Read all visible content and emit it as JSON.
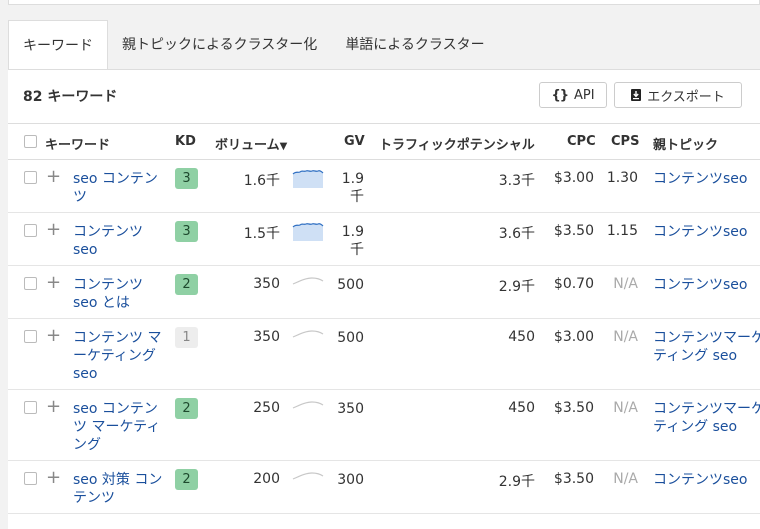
{
  "tabs": [
    {
      "label": "キーワード",
      "active": true
    },
    {
      "label": "親トピックによるクラスター化",
      "active": false
    },
    {
      "label": "単語によるクラスター",
      "active": false
    }
  ],
  "summary": {
    "count": "82",
    "count_label": "キーワード"
  },
  "toolbar": {
    "api_label": "API",
    "export_label": "エクスポート"
  },
  "table": {
    "headers": {
      "keyword": "キーワード",
      "kd": "KD",
      "volume": "ボリューム",
      "gv": "GV",
      "traffic_potential": "トラフィックポテンシャル",
      "cpc": "CPC",
      "cps": "CPS",
      "parent_topic": "親トピック"
    },
    "rows": [
      {
        "keyword": "seo コンテンツ",
        "kd": "3",
        "kd_color": "green",
        "volume": "1.6千",
        "trend": "high",
        "gv": "1.9千",
        "tp": "3.3千",
        "cpc": "$3.00",
        "cps": "1.30",
        "parent_topic": "コンテンツseo"
      },
      {
        "keyword": "コンテンツ seo",
        "kd": "3",
        "kd_color": "green",
        "volume": "1.5千",
        "trend": "high",
        "gv": "1.9千",
        "tp": "3.6千",
        "cpc": "$3.50",
        "cps": "1.15",
        "parent_topic": "コンテンツseo"
      },
      {
        "keyword": "コンテンツ seo とは",
        "kd": "2",
        "kd_color": "green",
        "volume": "350",
        "trend": "low",
        "gv": "500",
        "tp": "2.9千",
        "cpc": "$0.70",
        "cps": "N/A",
        "parent_topic": "コンテンツseo"
      },
      {
        "keyword": "コンテンツ マーケティング seo",
        "kd": "1",
        "kd_color": "grey",
        "volume": "350",
        "trend": "low",
        "gv": "500",
        "tp": "450",
        "cpc": "$3.00",
        "cps": "N/A",
        "parent_topic": "コンテンツマーケティング seo"
      },
      {
        "keyword": "seo コンテンツ マーケティング",
        "kd": "2",
        "kd_color": "green",
        "volume": "250",
        "trend": "low",
        "gv": "350",
        "tp": "450",
        "cpc": "$3.50",
        "cps": "N/A",
        "parent_topic": "コンテンツマーケティング seo"
      },
      {
        "keyword": "seo 対策 コンテンツ",
        "kd": "2",
        "kd_color": "green",
        "volume": "200",
        "trend": "low",
        "gv": "300",
        "tp": "2.9千",
        "cpc": "$3.50",
        "cps": "N/A",
        "parent_topic": "コンテンツseo"
      }
    ]
  }
}
